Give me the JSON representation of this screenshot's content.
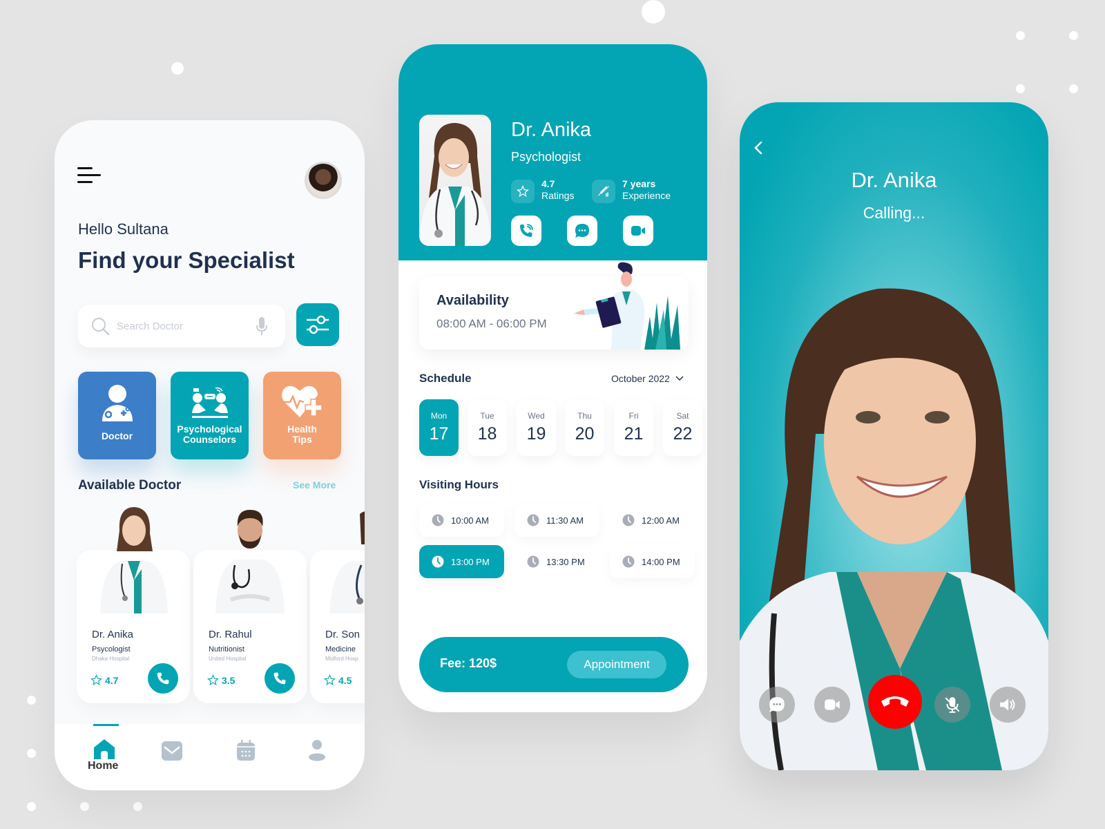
{
  "colors": {
    "primary": "#03a5b4",
    "doctor_card": "#3c7ec8",
    "health_card": "#f2a173",
    "hangup": "#ff0000",
    "text_dark": "#1f3150"
  },
  "home": {
    "greeting": "Hello Sultana",
    "headline": "Find your Specialist",
    "search": {
      "placeholder": "Search Doctor",
      "value": ""
    },
    "categories": [
      {
        "label_line1": "Doctor",
        "label_line2": "",
        "icon": "doctor-icon"
      },
      {
        "label_line1": "Psychological",
        "label_line2": "Counselors",
        "icon": "counseling-icon"
      },
      {
        "label_line1": "Health",
        "label_line2": "Tips",
        "icon": "heart-plus-icon"
      }
    ],
    "available_title": "Available Doctor",
    "see_more": "See More",
    "doctors": [
      {
        "name": "Dr. Anika",
        "specialty": "Psycologist",
        "hospital": "Dhaka Hospital",
        "rating": "4.7"
      },
      {
        "name": "Dr. Rahul",
        "specialty": "Nutritionist",
        "hospital": "United Hospital",
        "rating": "3.5"
      },
      {
        "name": "Dr. Son",
        "specialty": "Medicine",
        "hospital": "Midford Hosp",
        "rating": "4.5"
      }
    ],
    "nav": {
      "home_label": "Home",
      "items": [
        "home-icon",
        "mail-icon",
        "calendar-icon",
        "profile-icon"
      ]
    }
  },
  "profile": {
    "name": "Dr. Anika",
    "specialty": "Psychologist",
    "rating_value": "4.7",
    "rating_label": "Ratings",
    "experience_value": "7 years",
    "experience_label": "Experience",
    "availability_title": "Availability",
    "availability_time": "08:00 AM - 06:00 PM",
    "schedule_title": "Schedule",
    "month": "October 2022",
    "days": [
      {
        "name": "Mon",
        "num": "17",
        "active": true
      },
      {
        "name": "Tue",
        "num": "18",
        "active": false
      },
      {
        "name": "Wed",
        "num": "19",
        "active": false
      },
      {
        "name": "Thu",
        "num": "20",
        "active": false
      },
      {
        "name": "Fri",
        "num": "21",
        "active": false
      },
      {
        "name": "Sat",
        "num": "22",
        "active": false
      }
    ],
    "visiting_title": "Visiting Hours",
    "slots": [
      {
        "time": "10:00 AM",
        "active": false
      },
      {
        "time": "11:30 AM",
        "active": false
      },
      {
        "time": "12:00 AM",
        "active": false
      },
      {
        "time": "13:00 PM",
        "active": true
      },
      {
        "time": "13:30 PM",
        "active": false
      },
      {
        "time": "14:00 PM",
        "active": false
      }
    ],
    "fee": "Fee: 120$",
    "appointment_label": "Appointment"
  },
  "call": {
    "name": "Dr. Anika",
    "status": "Calling..."
  }
}
